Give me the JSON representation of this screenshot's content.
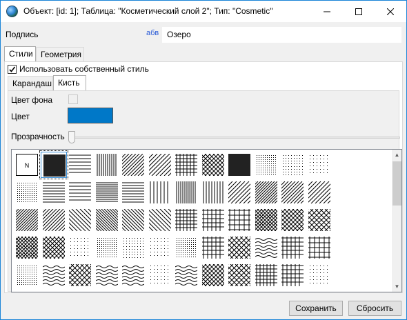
{
  "window": {
    "title": "Объект: [id: 1]; Таблица: \"Косметический слой 2\"; Тип: \"Cosmetic\""
  },
  "caption": {
    "label": "Подпись",
    "type_hint": "абв",
    "value": "Озеро"
  },
  "tabs_main": [
    {
      "label": "Стили",
      "selected": true
    },
    {
      "label": "Геометрия",
      "selected": false
    }
  ],
  "own_style": {
    "label": "Использовать собственный стиль",
    "checked": true
  },
  "tabs_sub": [
    {
      "label": "Карандаш",
      "selected": false
    },
    {
      "label": "Кисть",
      "selected": true
    }
  ],
  "brush": {
    "background_color_label": "Цвет фона",
    "color_label": "Цвет",
    "color_value": "#0078c8",
    "transparency_label": "Прозрачность",
    "transparency": 0
  },
  "patterns": {
    "first_cell_text": "N",
    "selected_index": 1,
    "types": [
      "none",
      "solid",
      "h",
      "v",
      "d1",
      "d1",
      "grid",
      "cross",
      "solid",
      "dots",
      "dots",
      "dots",
      "dots",
      "h",
      "h",
      "h",
      "h",
      "v",
      "v",
      "v",
      "d1",
      "d1",
      "d1",
      "d1",
      "d1",
      "d1",
      "d2",
      "d2",
      "d2",
      "d2",
      "grid",
      "grid",
      "grid",
      "cross",
      "cross",
      "cross",
      "cross",
      "cross",
      "dots",
      "dots",
      "dots",
      "dots",
      "dots",
      "grid",
      "cross",
      "wave",
      "grid",
      "grid",
      "dots",
      "wave",
      "cross",
      "wave",
      "wave",
      "dots",
      "wave",
      "cross",
      "cross",
      "grid",
      "grid",
      "dots"
    ]
  },
  "buttons": {
    "save": "Сохранить",
    "reset": "Сбросить"
  }
}
